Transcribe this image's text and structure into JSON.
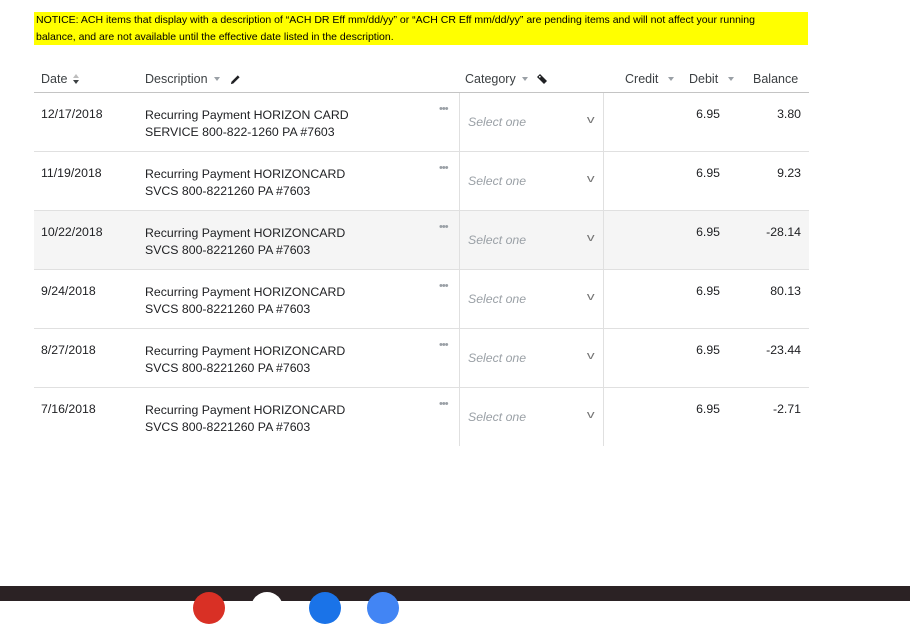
{
  "notice": {
    "line1": "NOTICE: ACH items that display with a description of “ACH DR Eff mm/dd/yy” or “ACH CR Eff mm/dd/yy” are pending items and will not affect your running",
    "line2": "balance, and are not available until the effective date listed in the description."
  },
  "headers": {
    "date": "Date",
    "description": "Description",
    "category": "Category",
    "credit": "Credit",
    "debit": "Debit",
    "balance": "Balance"
  },
  "category_placeholder": "Select one",
  "more_glyph": "•••",
  "chevron_glyph": "v",
  "transactions": [
    {
      "date": "12/17/2018",
      "desc1": "Recurring Payment HORIZON CARD",
      "desc2": "SERVICE 800-822-1260 PA #7603",
      "credit": "",
      "debit": "6.95",
      "balance": "3.80"
    },
    {
      "date": "11/19/2018",
      "desc1": "Recurring Payment HORIZONCARD",
      "desc2": "SVCS 800-8221260 PA #7603",
      "credit": "",
      "debit": "6.95",
      "balance": "9.23"
    },
    {
      "date": "10/22/2018",
      "desc1": "Recurring Payment HORIZONCARD",
      "desc2": "SVCS 800-8221260 PA #7603",
      "credit": "",
      "debit": "6.95",
      "balance": "-28.14"
    },
    {
      "date": "9/24/2018",
      "desc1": "Recurring Payment HORIZONCARD",
      "desc2": "SVCS 800-8221260 PA #7603",
      "credit": "",
      "debit": "6.95",
      "balance": "80.13"
    },
    {
      "date": "8/27/2018",
      "desc1": "Recurring Payment HORIZONCARD",
      "desc2": "SVCS 800-8221260 PA #7603",
      "credit": "",
      "debit": "6.95",
      "balance": "-23.44"
    },
    {
      "date": "7/16/2018",
      "desc1": "Recurring Payment HORIZONCARD",
      "desc2": "SVCS 800-8221260 PA #7603",
      "credit": "",
      "debit": "6.95",
      "balance": "-2.71"
    }
  ],
  "colors": {
    "notice_bg": "#ffff00",
    "row_alt_bg": "#f5f5f5",
    "taskbar": "#2b2224",
    "dock_icons": [
      "#d93025",
      "#ffffff",
      "#1a73e8",
      "#4285f4"
    ]
  },
  "icons": {
    "date_sort": "sort-icon",
    "description": "pencil-icon",
    "category": "tag-icon"
  }
}
